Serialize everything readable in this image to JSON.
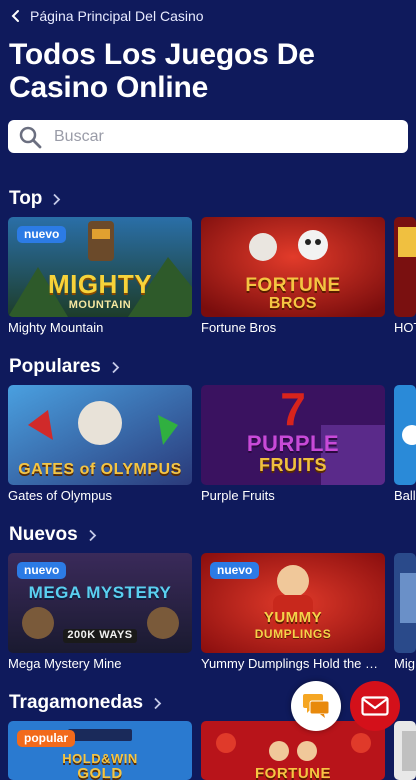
{
  "header": {
    "back_label": "Página Principal Del Casino",
    "title": "Todos Los Juegos De Casino Online"
  },
  "search": {
    "placeholder": "Buscar"
  },
  "sections": [
    {
      "title": "Top",
      "games": [
        {
          "name": "Mighty Mountain",
          "badge": "nuevo",
          "art_text": "MIGHTY",
          "art_sub": "MOUNTAIN"
        },
        {
          "name": "Fortune Bros",
          "badge": "",
          "art_text": "FORTUNE",
          "art_sub": "BROS"
        },
        {
          "name": "HOT",
          "badge": "",
          "art_text": "",
          "art_sub": ""
        }
      ]
    },
    {
      "title": "Populares",
      "games": [
        {
          "name": "Gates of Olympus",
          "badge": "",
          "art_text": "GATES of OLYMPUS",
          "art_sub": ""
        },
        {
          "name": "Purple Fruits",
          "badge": "",
          "art_text": "PURPLE",
          "art_sub": "FRUITS"
        },
        {
          "name": "Ballo",
          "badge": "",
          "art_text": "",
          "art_sub": ""
        }
      ]
    },
    {
      "title": "Nuevos",
      "games": [
        {
          "name": "Mega Mystery Mine",
          "badge": "nuevo",
          "art_text": "MEGA MYSTERY",
          "art_sub": "200K WAYS"
        },
        {
          "name": "Yummy Dumplings Hold the Spin",
          "badge": "nuevo",
          "art_text": "YUMMY",
          "art_sub": "DUMPLINGS"
        },
        {
          "name": "Mig",
          "badge": "",
          "art_text": "",
          "art_sub": ""
        }
      ]
    },
    {
      "title": "Tragamonedas",
      "games": [
        {
          "name": "",
          "badge": "popular",
          "art_text": "HOLD&WIN",
          "art_sub": "GOLD"
        },
        {
          "name": "",
          "badge": "",
          "art_text": "FORTUNE",
          "art_sub": ""
        },
        {
          "name": "",
          "badge": "",
          "art_text": "",
          "art_sub": ""
        }
      ]
    }
  ],
  "colors": {
    "background": "#0f1a5c",
    "badge_new": "#2c7be5",
    "badge_popular": "#f26a1b",
    "mail_button": "#d4101a"
  },
  "icons": {
    "back": "chevron-left-icon",
    "search": "search-icon",
    "section_more": "chevron-right-icon",
    "chat": "chat-bubbles-icon",
    "mail": "envelope-icon"
  }
}
